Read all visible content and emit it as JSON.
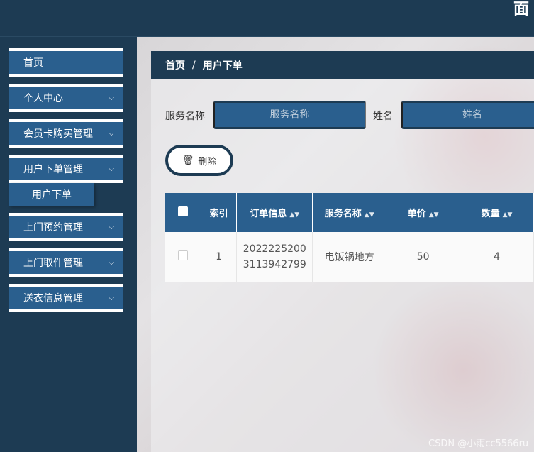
{
  "header": {
    "title": "面"
  },
  "sidebar": {
    "items": [
      {
        "label": "首页",
        "has_chevron": false
      },
      {
        "label": "个人中心",
        "has_chevron": true
      },
      {
        "label": "会员卡购买管理",
        "has_chevron": true
      },
      {
        "label": "用户下单管理",
        "has_chevron": true
      },
      {
        "label": "上门预约管理",
        "has_chevron": true
      },
      {
        "label": "上门取件管理",
        "has_chevron": true
      },
      {
        "label": "送衣信息管理",
        "has_chevron": true
      }
    ],
    "sub_items": [
      {
        "label": "用户下单"
      }
    ]
  },
  "breadcrumb": {
    "home": "首页",
    "separator": "/",
    "current": "用户下单"
  },
  "search": {
    "service_label": "服务名称",
    "service_placeholder": "服务名称",
    "name_label": "姓名",
    "name_placeholder": "姓名"
  },
  "toolbar": {
    "delete_label": "删除",
    "delete_icon": "trash-icon"
  },
  "table": {
    "columns": [
      {
        "label": "",
        "sortable": false
      },
      {
        "label": "索引",
        "sortable": false
      },
      {
        "label": "订单信息",
        "sortable": true
      },
      {
        "label": "服务名称",
        "sortable": true
      },
      {
        "label": "单价",
        "sortable": true
      },
      {
        "label": "数量",
        "sortable": true
      }
    ],
    "rows": [
      {
        "index": "1",
        "order_line1": "2022225200",
        "order_line2": "3113942799",
        "service": "电饭锅地方",
        "price": "50",
        "quantity": "4"
      }
    ]
  },
  "watermark": "CSDN @小雨cc5566ru",
  "colors": {
    "header_bg": "#1d3b53",
    "accent": "#2a5f8e",
    "white": "#ffffff"
  }
}
